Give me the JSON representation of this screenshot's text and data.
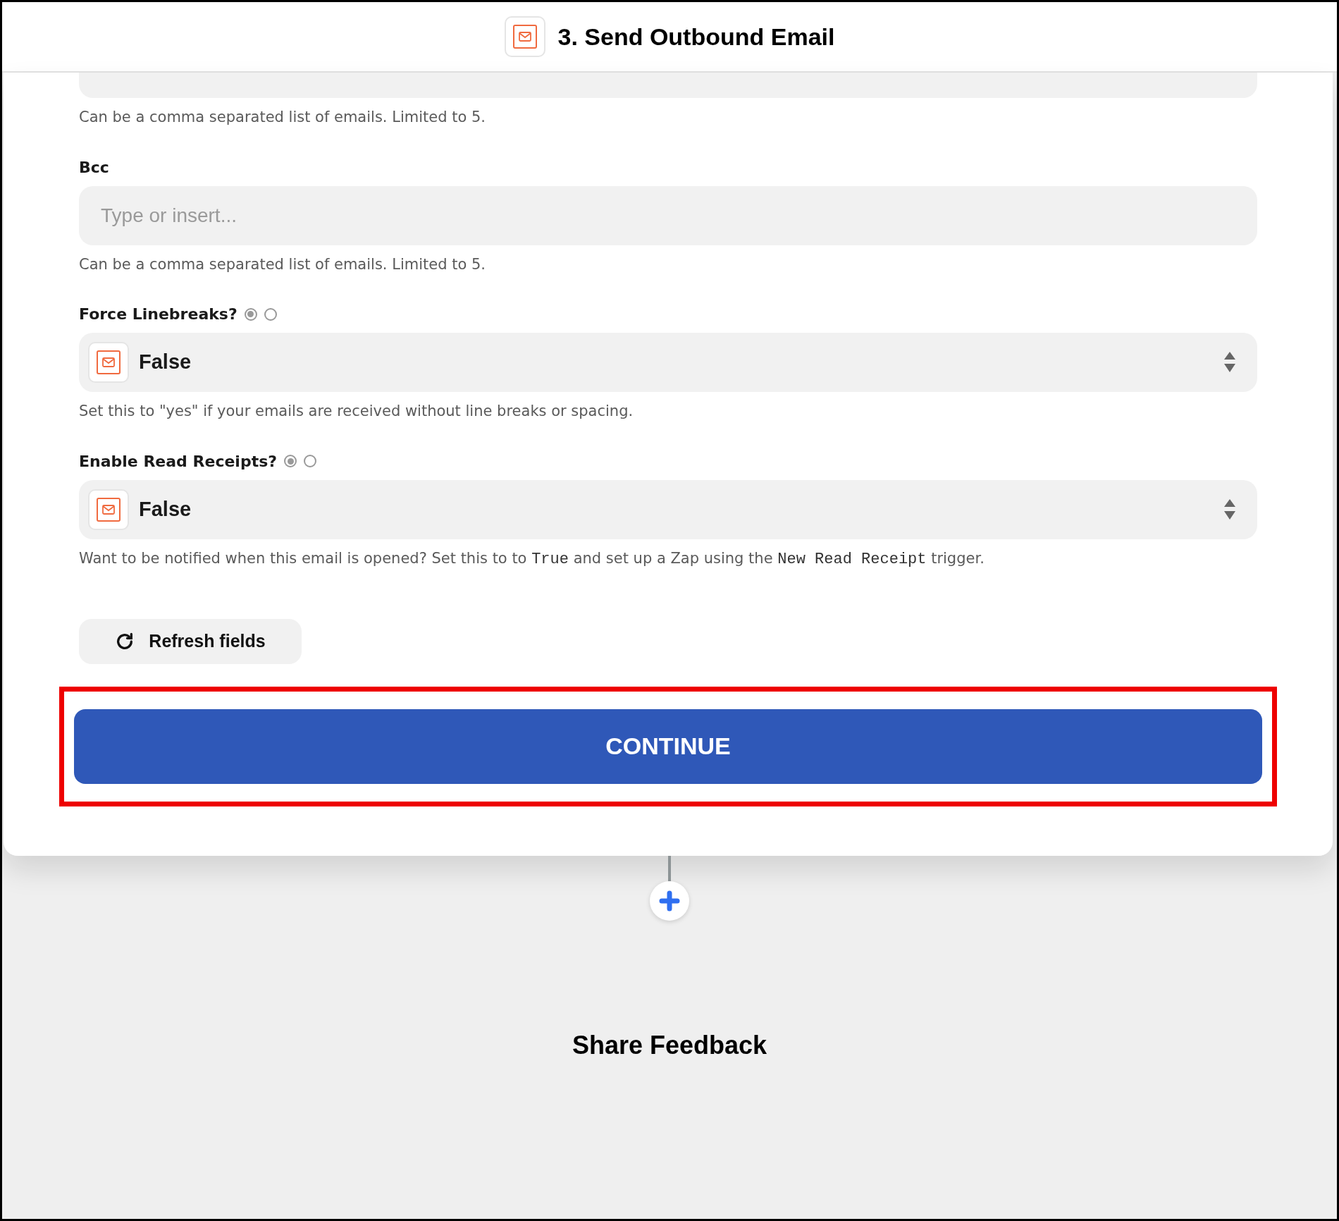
{
  "header": {
    "title": "3. Send Outbound Email"
  },
  "fields": [
    {
      "kind": "partial",
      "hint_parts": [
        {
          "text": "Can be a comma separated list of emails. Limited to 5.",
          "code": false
        }
      ]
    },
    {
      "kind": "text",
      "label": "Bcc",
      "placeholder": "Type or insert...",
      "hint_parts": [
        {
          "text": "Can be a comma separated list of emails. Limited to 5.",
          "code": false
        }
      ]
    },
    {
      "kind": "select",
      "label": "Force Linebreaks?",
      "options": [
        {
          "selected": true
        },
        {
          "selected": false
        }
      ],
      "value": "False",
      "hint_parts": [
        {
          "text": "Set this to \"yes\" if your emails are received without line breaks or spacing.",
          "code": false
        }
      ]
    },
    {
      "kind": "select",
      "label": "Enable Read Receipts?",
      "options": [
        {
          "selected": true
        },
        {
          "selected": false
        }
      ],
      "value": "False",
      "hint_parts": [
        {
          "text": "Want to be notified when this email is opened? Set this to to ",
          "code": false
        },
        {
          "text": "True",
          "code": true
        },
        {
          "text": " and set up a Zap using the ",
          "code": false
        },
        {
          "text": "New Read Receipt",
          "code": true
        },
        {
          "text": " trigger.",
          "code": false
        }
      ]
    }
  ],
  "refresh_button": "Refresh fields",
  "continue_button": {
    "label": "CONTINUE",
    "highlighted": true
  },
  "footer": {
    "link": "Share Feedback"
  }
}
